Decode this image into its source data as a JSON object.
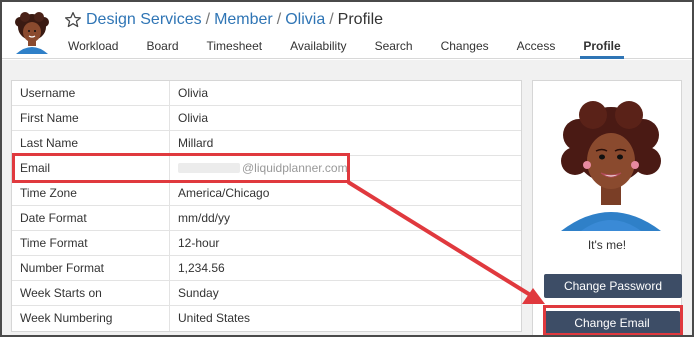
{
  "breadcrumb": {
    "items": [
      "Design Services",
      "Member",
      "Olivia"
    ],
    "separator": "/",
    "current": "Profile"
  },
  "tabs": [
    {
      "label": "Workload"
    },
    {
      "label": "Board"
    },
    {
      "label": "Timesheet"
    },
    {
      "label": "Availability"
    },
    {
      "label": "Search"
    },
    {
      "label": "Changes"
    },
    {
      "label": "Access"
    },
    {
      "label": "Profile",
      "active": true
    }
  ],
  "profile_rows": [
    {
      "label": "Username",
      "value": "Olivia"
    },
    {
      "label": "First Name",
      "value": "Olivia"
    },
    {
      "label": "Last Name",
      "value": "Millard"
    },
    {
      "label": "Email",
      "value": "@liquidplanner.com"
    },
    {
      "label": "Time Zone",
      "value": "America/Chicago"
    },
    {
      "label": "Date Format",
      "value": "mm/dd/yy"
    },
    {
      "label": "Time Format",
      "value": "12-hour"
    },
    {
      "label": "Number Format",
      "value": "1,234.56"
    },
    {
      "label": "Week Starts on",
      "value": "Sunday"
    },
    {
      "label": "Week Numbering",
      "value": "United States"
    }
  ],
  "panel": {
    "caption": "It's me!",
    "change_password": "Change Password",
    "change_email": "Change Email"
  },
  "colors": {
    "link": "#2f75b5",
    "button": "#3d4d66",
    "highlight": "#e0393e"
  }
}
